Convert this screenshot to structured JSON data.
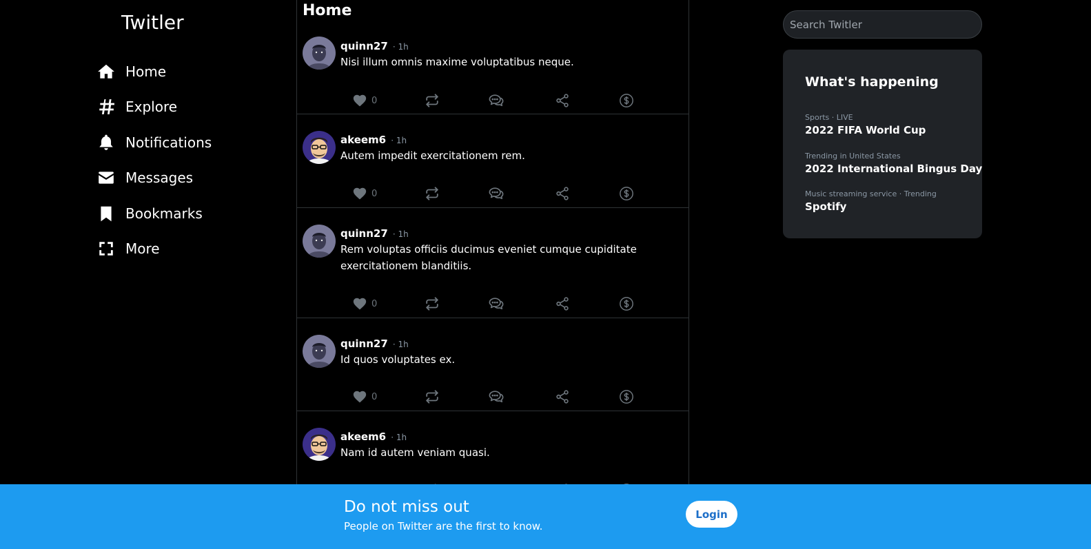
{
  "app": {
    "title": "Twitler"
  },
  "sidebar": {
    "items": [
      {
        "label": "Home",
        "icon": "home-icon"
      },
      {
        "label": "Explore",
        "icon": "hashtag-icon"
      },
      {
        "label": "Notifications",
        "icon": "bell-icon"
      },
      {
        "label": "Messages",
        "icon": "envelope-icon"
      },
      {
        "label": "Bookmarks",
        "icon": "bookmark-icon"
      },
      {
        "label": "More",
        "icon": "expand-icon"
      }
    ]
  },
  "feed": {
    "title": "Home",
    "tweets": [
      {
        "user": "quinn27",
        "time": "· 1h",
        "text": "Nisi illum omnis maxime voluptatibus neque.",
        "likes": "0",
        "avatar": "avatar-quinn27"
      },
      {
        "user": "akeem6",
        "time": "· 1h",
        "text": "Autem impedit exercitationem rem.",
        "likes": "0",
        "avatar": "avatar-akeem6"
      },
      {
        "user": "quinn27",
        "time": "· 1h",
        "text": "Rem voluptas officiis ducimus eveniet cumque cupiditate exercitationem blanditiis.",
        "likes": "0",
        "avatar": "avatar-quinn27"
      },
      {
        "user": "quinn27",
        "time": "· 1h",
        "text": "Id quos voluptates ex.",
        "likes": "0",
        "avatar": "avatar-quinn27"
      },
      {
        "user": "akeem6",
        "time": "· 1h",
        "text": "Nam id autem veniam quasi.",
        "likes": "0",
        "avatar": "avatar-akeem6"
      }
    ]
  },
  "search": {
    "placeholder": "Search Twitler"
  },
  "trends": {
    "title": "What's happening",
    "items": [
      {
        "category": "Sports · LIVE",
        "name": "2022 FIFA World Cup"
      },
      {
        "category": "Trending in United States",
        "name": "2022 International Bingus Day"
      },
      {
        "category": "Music streaming service · Trending",
        "name": "Spotify"
      }
    ]
  },
  "banner": {
    "title": "Do not miss out",
    "subtitle": "People on Twitter are the first to know.",
    "login_label": "Login"
  },
  "colors": {
    "background": "#000000",
    "accent": "#1d9bf0",
    "card": "#202327",
    "muted": "#8b98a5",
    "action_icon": "#6e767d"
  }
}
